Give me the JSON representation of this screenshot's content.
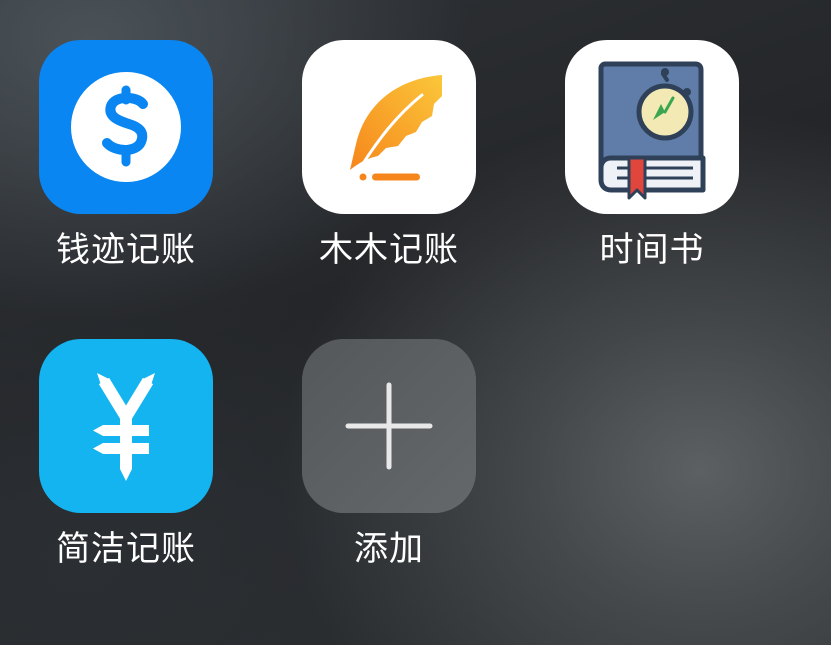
{
  "apps": [
    {
      "id": "qianji",
      "label": "钱迹记账",
      "icon": "dollar-coin-icon",
      "tile_color": "#0a86f2"
    },
    {
      "id": "mumu",
      "label": "木木记账",
      "icon": "feather-quill-icon",
      "tile_color": "#ffffff"
    },
    {
      "id": "shijian",
      "label": "时间书",
      "icon": "clock-book-icon",
      "tile_color": "#ffffff"
    },
    {
      "id": "jianjie",
      "label": "简洁记账",
      "icon": "yen-symbol-icon",
      "tile_color": "#14b4f0"
    }
  ],
  "add_tile": {
    "label": "添加",
    "icon": "plus-icon",
    "tile_color": "#5a5d60"
  }
}
